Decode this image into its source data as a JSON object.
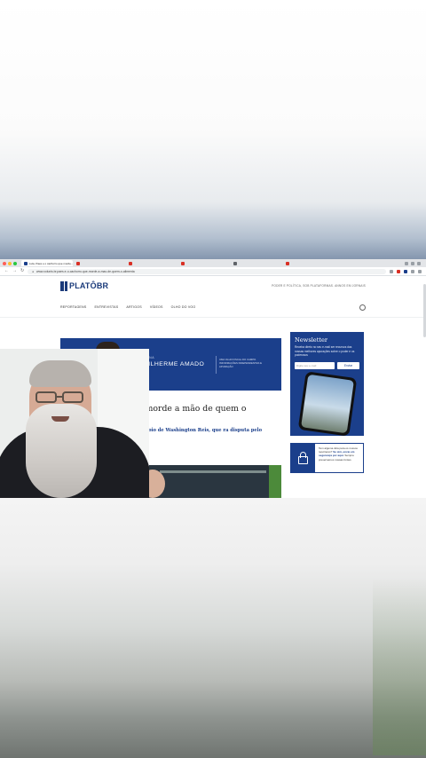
{
  "browser": {
    "tabs": [
      {
        "title": "Lula, Paes e o cachorro que morde...",
        "active": true,
        "favicon_color": "#1b3f8b"
      },
      {
        "title": "",
        "active": false,
        "favicon_color": "#d93025"
      },
      {
        "title": "",
        "active": false,
        "favicon_color": "#d93025"
      },
      {
        "title": "",
        "active": false,
        "favicon_color": "#d93025"
      },
      {
        "title": "",
        "active": false,
        "favicon_color": "#5f6368"
      },
      {
        "title": "",
        "active": false,
        "favicon_color": "#d93025"
      }
    ],
    "url": "www.colunis.br.paes.e-o-cachorro-que-morde-a-mao-de-quem-o-alimenta",
    "nav_icons": [
      "back-icon",
      "forward-icon",
      "reload-icon"
    ]
  },
  "site": {
    "logo_text": "PLATÔBR",
    "header_links": "PODER E POLÍTICA, SOB PLATAFORMAS. ANNOS EM JORNAIS",
    "nav": [
      "REPORTAGENS",
      "ENTREVISTAS",
      "ARTIGOS",
      "VÍDEOS",
      "OLHO DO VOO"
    ]
  },
  "banner": {
    "kicker": "COLUNA",
    "name": "GUILHERME AMADO",
    "description": "UMA OLHO FISCAL DO CAMPO. INFORMAÇÕES INDEPENDENTES E APURAÇÃO"
  },
  "article": {
    "headline": "es e o cachorro que morde a mão de quem o",
    "dek": "Eduardo Paes, Lula questionou apoio de Washington Reis, que ra disputa pelo governo do RJ"
  },
  "newsletter": {
    "title": "Newsletter",
    "text": "Receba direto no seu e-mail ser recursos das nossas melhores apurações sobre o poder e os poderosos",
    "input_placeholder": "Digite seu e-mail",
    "button_label": "Enviar"
  },
  "promo_card": {
    "text_before": "Tem alguma dica para os nossos repórteres?",
    "text_bold": "Se sim, envie em segurança por aqui.",
    "text_after": "Sempre preservamos nossas fontes"
  },
  "colors": {
    "brand_blue": "#1b3f8b"
  }
}
